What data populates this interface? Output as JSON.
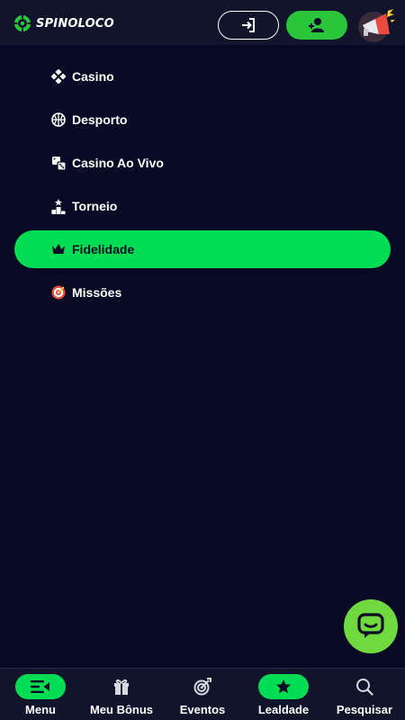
{
  "header": {
    "logo_text": "SPINOLOCO",
    "login_icon": "login-arrow-icon",
    "register_icon": "user-plus-icon",
    "promo_icon": "megaphone-icon"
  },
  "menu": {
    "items": [
      {
        "label": "Casino",
        "icon": "diamond-suit-icon",
        "active": false
      },
      {
        "label": "Desporto",
        "icon": "basketball-icon",
        "active": false
      },
      {
        "label": "Casino Ao Vivo",
        "icon": "dice-icon",
        "active": false
      },
      {
        "label": "Torneio",
        "icon": "podium-icon",
        "active": false
      },
      {
        "label": "Fidelidade",
        "icon": "crown-icon",
        "active": true
      },
      {
        "label": "Missões",
        "icon": "target-icon",
        "active": false
      }
    ]
  },
  "chat": {
    "icon": "chat-bubble-icon"
  },
  "bottom_nav": {
    "items": [
      {
        "label": "Menu",
        "icon": "menu-icon",
        "active": true
      },
      {
        "label": "Meu Bônus",
        "icon": "gift-icon",
        "active": false
      },
      {
        "label": "Eventos",
        "icon": "target-arrow-icon",
        "active": false
      },
      {
        "label": "Lealdade",
        "icon": "star-icon",
        "active": true
      },
      {
        "label": "Pesquisar",
        "icon": "search-icon",
        "active": false
      }
    ]
  },
  "colors": {
    "background": "#080a25",
    "header": "#12142b",
    "accent": "#00dd52",
    "register_button": "#2bc53c",
    "chat_button": "#6fd93d"
  }
}
